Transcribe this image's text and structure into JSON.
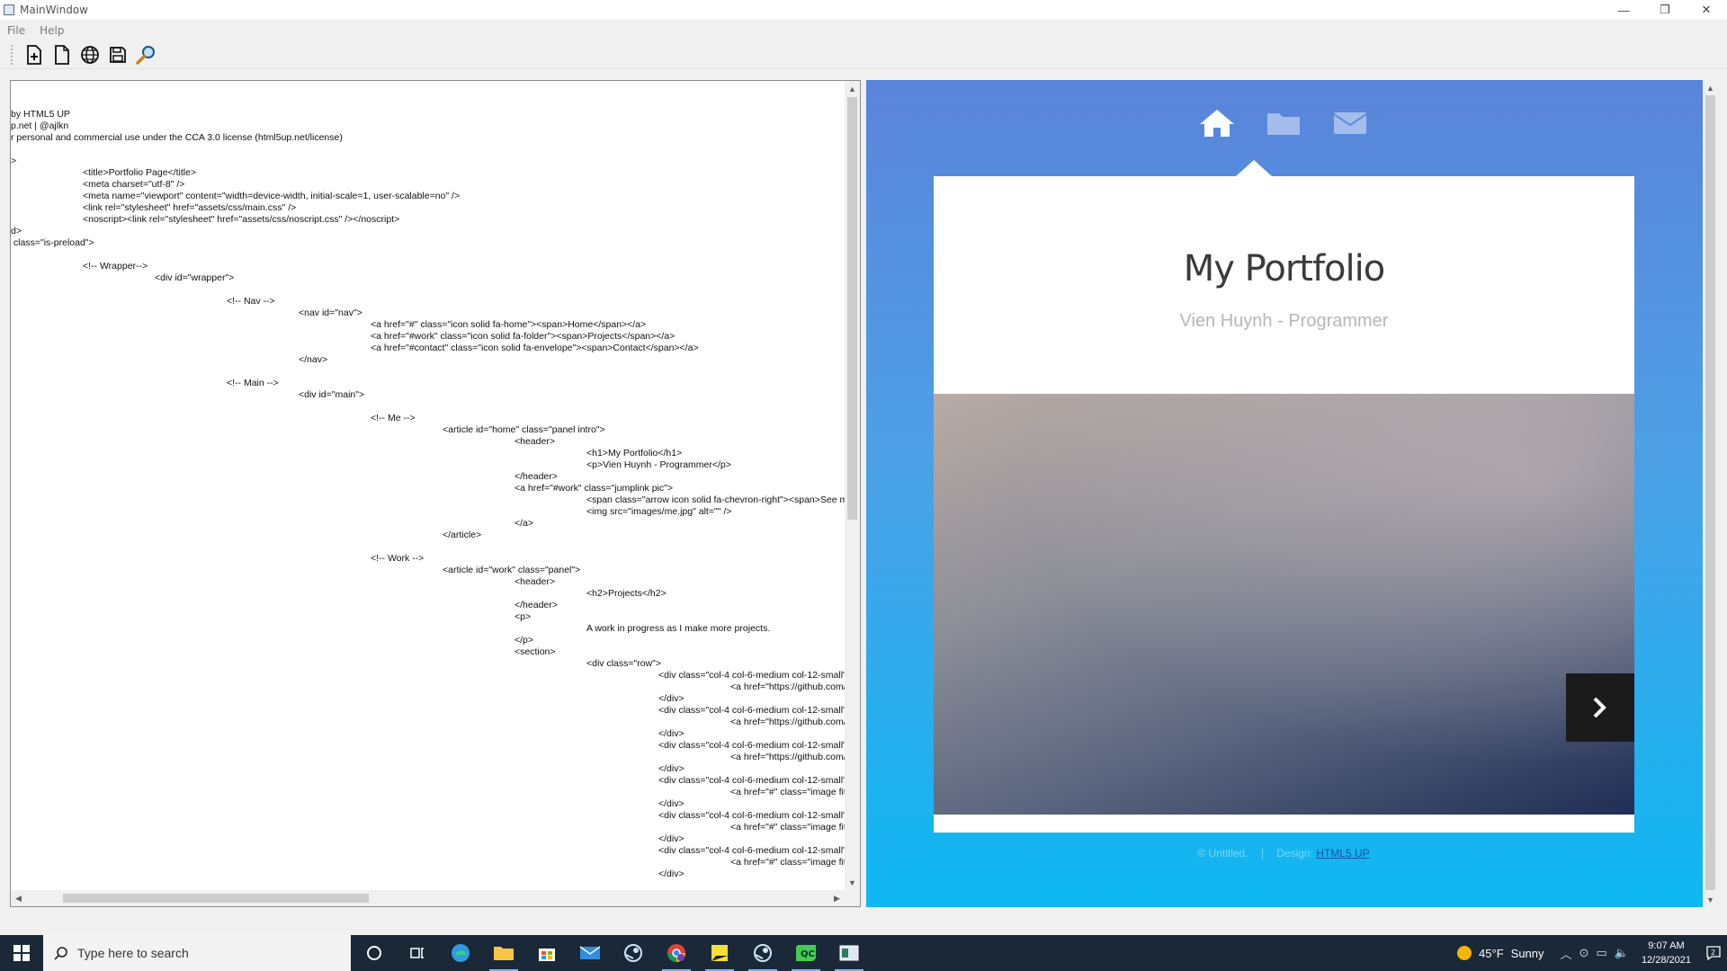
{
  "window": {
    "title": "MainWindow",
    "minimize": "—",
    "restore": "❐",
    "close": "✕"
  },
  "menu": [
    "File",
    "Help"
  ],
  "toolbar": {
    "buttons": [
      "new-file-plus-icon",
      "new-document-icon",
      "web-preview-icon",
      "save-icon",
      "find-icon"
    ]
  },
  "editor": {
    "lines": [
      {
        "indent": 0,
        "text": "by HTML5 UP"
      },
      {
        "indent": 0,
        "text": "p.net | @ajlkn"
      },
      {
        "indent": 0,
        "text": "r personal and commercial use under the CCA 3.0 license (html5up.net/license)"
      },
      {
        "indent": 0,
        "text": ""
      },
      {
        "indent": 0,
        "text": ">"
      },
      {
        "indent": 1,
        "text": "<title>Portfolio Page</title>"
      },
      {
        "indent": 1,
        "text": "<meta charset=\"utf-8\" />"
      },
      {
        "indent": 1,
        "text": "<meta name=\"viewport\" content=\"width=device-width, initial-scale=1, user-scalable=no\" />"
      },
      {
        "indent": 1,
        "text": "<link rel=\"stylesheet\" href=\"assets/css/main.css\" />"
      },
      {
        "indent": 1,
        "text": "<noscript><link rel=\"stylesheet\" href=\"assets/css/noscript.css\" /></noscript>"
      },
      {
        "indent": 0,
        "text": "d>"
      },
      {
        "indent": 0,
        "text": " class=\"is-preload\">"
      },
      {
        "indent": 0,
        "text": ""
      },
      {
        "indent": 1,
        "text": "<!-- Wrapper-->"
      },
      {
        "indent": 2,
        "text": "<div id=\"wrapper\">"
      },
      {
        "indent": 0,
        "text": ""
      },
      {
        "indent": 3,
        "text": "<!-- Nav -->"
      },
      {
        "indent": 4,
        "text": "<nav id=\"nav\">"
      },
      {
        "indent": 5,
        "text": "<a href=\"#\" class=\"icon solid fa-home\"><span>Home</span></a>"
      },
      {
        "indent": 5,
        "text": "<a href=\"#work\" class=\"icon solid fa-folder\"><span>Projects</span></a>"
      },
      {
        "indent": 5,
        "text": "<a href=\"#contact\" class=\"icon solid fa-envelope\"><span>Contact</span></a>"
      },
      {
        "indent": 4,
        "text": "</nav>"
      },
      {
        "indent": 0,
        "text": ""
      },
      {
        "indent": 3,
        "text": "<!-- Main -->"
      },
      {
        "indent": 4,
        "text": "<div id=\"main\">"
      },
      {
        "indent": 0,
        "text": ""
      },
      {
        "indent": 5,
        "text": "<!-- Me -->"
      },
      {
        "indent": 6,
        "text": "<article id=\"home\" class=\"panel intro\">"
      },
      {
        "indent": 7,
        "text": "<header>"
      },
      {
        "indent": 8,
        "text": "<h1>My Portfolio</h1>"
      },
      {
        "indent": 8,
        "text": "<p>Vien Huynh - Programmer</p>"
      },
      {
        "indent": 7,
        "text": "</header>"
      },
      {
        "indent": 7,
        "text": "<a href=\"#work\" class=\"jumplink pic\">"
      },
      {
        "indent": 8,
        "text": "<span class=\"arrow icon solid fa-chevron-right\"><span>See my w"
      },
      {
        "indent": 8,
        "text": "<img src=\"images/me.jpg\" alt=\"\" />"
      },
      {
        "indent": 7,
        "text": "</a>"
      },
      {
        "indent": 6,
        "text": "</article>"
      },
      {
        "indent": 0,
        "text": ""
      },
      {
        "indent": 5,
        "text": "<!-- Work -->"
      },
      {
        "indent": 6,
        "text": "<article id=\"work\" class=\"panel\">"
      },
      {
        "indent": 7,
        "text": "<header>"
      },
      {
        "indent": 8,
        "text": "<h2>Projects</h2>"
      },
      {
        "indent": 7,
        "text": "</header>"
      },
      {
        "indent": 7,
        "text": "<p>"
      },
      {
        "indent": 8,
        "text": "A work in progress as I make more projects."
      },
      {
        "indent": 7,
        "text": "</p>"
      },
      {
        "indent": 7,
        "text": "<section>"
      },
      {
        "indent": 8,
        "text": "<div class=\"row\">"
      },
      {
        "indent": 9,
        "text": "<div class=\"col-4 col-6-medium col-12-small\">"
      },
      {
        "indent": 10,
        "text": "<a href=\"https://github.com/Vhu"
      },
      {
        "indent": 9,
        "text": "</div>"
      },
      {
        "indent": 9,
        "text": "<div class=\"col-4 col-6-medium col-12-small\">"
      },
      {
        "indent": 10,
        "text": "<a href=\"https://github.com/gav"
      },
      {
        "indent": 9,
        "text": "</div>"
      },
      {
        "indent": 9,
        "text": "<div class=\"col-4 col-6-medium col-12-small\">"
      },
      {
        "indent": 10,
        "text": "<a href=\"https://github.com/Vhu"
      },
      {
        "indent": 9,
        "text": "</div>"
      },
      {
        "indent": 9,
        "text": "<div class=\"col-4 col-6-medium col-12-small\">"
      },
      {
        "indent": 10,
        "text": "<a href=\"#\" class=\"image fit\"><"
      },
      {
        "indent": 9,
        "text": "</div>"
      },
      {
        "indent": 9,
        "text": "<div class=\"col-4 col-6-medium col-12-small\">"
      },
      {
        "indent": 10,
        "text": "<a href=\"#\" class=\"image fit\"><"
      },
      {
        "indent": 9,
        "text": "</div>"
      },
      {
        "indent": 9,
        "text": "<div class=\"col-4 col-6-medium col-12-small\">"
      },
      {
        "indent": 10,
        "text": "<a href=\"#\" class=\"image fit\"><"
      },
      {
        "indent": 9,
        "text": "</div>"
      }
    ]
  },
  "preview": {
    "nav": [
      "home-icon",
      "folder-icon",
      "envelope-icon"
    ],
    "title": "My Portfolio",
    "subtitle": "Vien Huynh - Programmer",
    "footer_copyright": "© Untitled.",
    "footer_design_label": "Design:",
    "footer_design_link": "HTML5 UP"
  },
  "taskbar": {
    "search_placeholder": "Type here to search",
    "apps": [
      "task-view-icon",
      "widgets-icon",
      "edge-icon",
      "file-explorer-icon",
      "store-icon",
      "mail-icon",
      "steam-icon",
      "chrome-icon",
      "sticky-notes-icon",
      "steam-icon",
      "qt-creator-icon",
      "app-window-icon"
    ],
    "weather_temp": "45°F",
    "weather_desc": "Sunny",
    "time": "9:07 AM",
    "date": "12/28/2021",
    "notifications": "2"
  }
}
